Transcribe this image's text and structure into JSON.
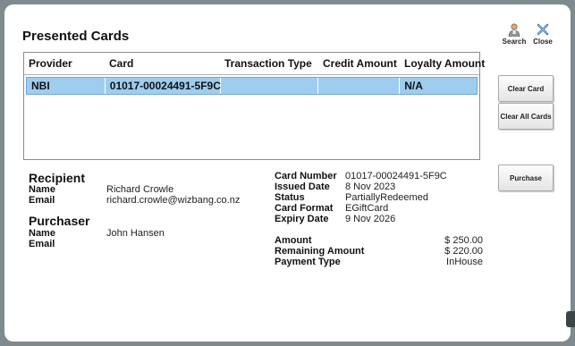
{
  "title": "Presented Cards",
  "toolbar": {
    "search_label": "Search",
    "close_label": "Close"
  },
  "grid": {
    "columns": [
      "Provider",
      "Card",
      "Transaction Type",
      "Credit Amount",
      "Loyalty Amount"
    ],
    "rows": [
      {
        "provider": "NBI",
        "card": "01017-00024491-5F9C",
        "transaction_type": "",
        "credit_amount": "",
        "loyalty_amount": "N/A",
        "selected": true
      }
    ]
  },
  "side_buttons": {
    "clear_card": "Clear Card",
    "clear_all_cards": "Clear All Cards",
    "purchase": "Purchase"
  },
  "recipient": {
    "heading": "Recipient",
    "name_label": "Name",
    "name": "Richard Crowle",
    "email_label": "Email",
    "email": "richard.crowle@wizbang.co.nz"
  },
  "purchaser": {
    "heading": "Purchaser",
    "name_label": "Name",
    "name": "John Hansen",
    "email_label": "Email",
    "email": ""
  },
  "card_details": {
    "number_label": "Card Number",
    "number": "01017-00024491-5F9C",
    "issued_label": "Issued Date",
    "issued": "8 Nov 2023",
    "status_label": "Status",
    "status": "PartiallyRedeemed",
    "format_label": "Card Format",
    "format": "EGiftCard",
    "expiry_label": "Expiry Date",
    "expiry": "9 Nov 2026"
  },
  "amounts": {
    "amount_label": "Amount",
    "amount": "$ 250.00",
    "remaining_label": "Remaining Amount",
    "remaining": "$ 220.00",
    "payment_type_label": "Payment Type",
    "payment_type": "InHouse"
  },
  "colors": {
    "selected_row": "#9fcdf0",
    "backdrop": "#7f8a8e"
  }
}
